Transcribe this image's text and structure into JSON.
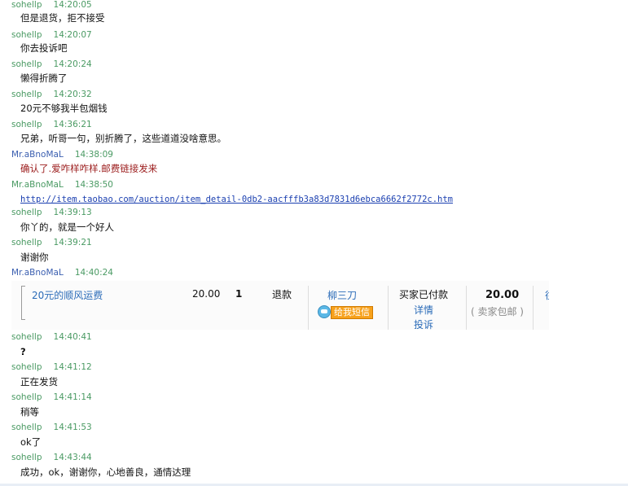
{
  "messages": [
    {
      "nick": "sohellp",
      "time": "14:20:05",
      "text": "但是退货，拒不接受"
    },
    {
      "nick": "sohellp",
      "time": "14:20:07",
      "text": "你去投诉吧"
    },
    {
      "nick": "sohellp",
      "time": "14:20:24",
      "text": "懒得折腾了"
    },
    {
      "nick": "sohellp",
      "time": "14:20:32",
      "text": "20元不够我半包烟钱"
    },
    {
      "nick": "sohellp",
      "time": "14:36:21",
      "text": "兄弟，听哥一句，别折腾了，这些道道没啥意思。"
    },
    {
      "nick": "Mr.aBnoMaL",
      "time": "14:38:09",
      "text": "确认了.爱咋样咋样.邮费链接发来"
    },
    {
      "nick": "Mr.aBnoMaL",
      "time": "14:38:50",
      "text": "http://item.taobao.com/auction/item_detail-0db2-aacfffb3a83d7831d6ebca6662f2772c.htm"
    },
    {
      "nick": "sohellp",
      "time": "14:39:13",
      "text": "你丫的，就是一个好人"
    },
    {
      "nick": "sohellp",
      "time": "14:39:21",
      "text": "谢谢你"
    },
    {
      "nick": "Mr.aBnoMaL",
      "time": "14:40:24",
      "text": ""
    },
    {
      "nick": "sohellp",
      "time": "14:40:41",
      "text": "?"
    },
    {
      "nick": "sohellp",
      "time": "14:41:12",
      "text": "正在发货"
    },
    {
      "nick": "sohellp",
      "time": "14:41:14",
      "text": "稍等"
    },
    {
      "nick": "sohellp",
      "time": "14:41:53",
      "text": "ok了"
    },
    {
      "nick": "sohellp",
      "time": "14:43:44",
      "text": "成功，ok，谢谢你，心地善良，通情达理"
    }
  ],
  "order": {
    "item_name": "20元的顺风运费",
    "price": "20.00",
    "quantity": "1",
    "refund": "退款",
    "seller": "柳三刀",
    "sms_button": "给我短信",
    "status": "买家已付款",
    "details_link": "详情",
    "complain_link": "投诉",
    "total": "20.00",
    "shipping_note": "( 卖家包邮 )",
    "truncated_col": "往"
  },
  "colors": {
    "nick_green": "#4a9a63",
    "nick_blue": "#3b5fb0",
    "link_blue": "#1a3fb0",
    "red_text": "#9b1b1b"
  }
}
